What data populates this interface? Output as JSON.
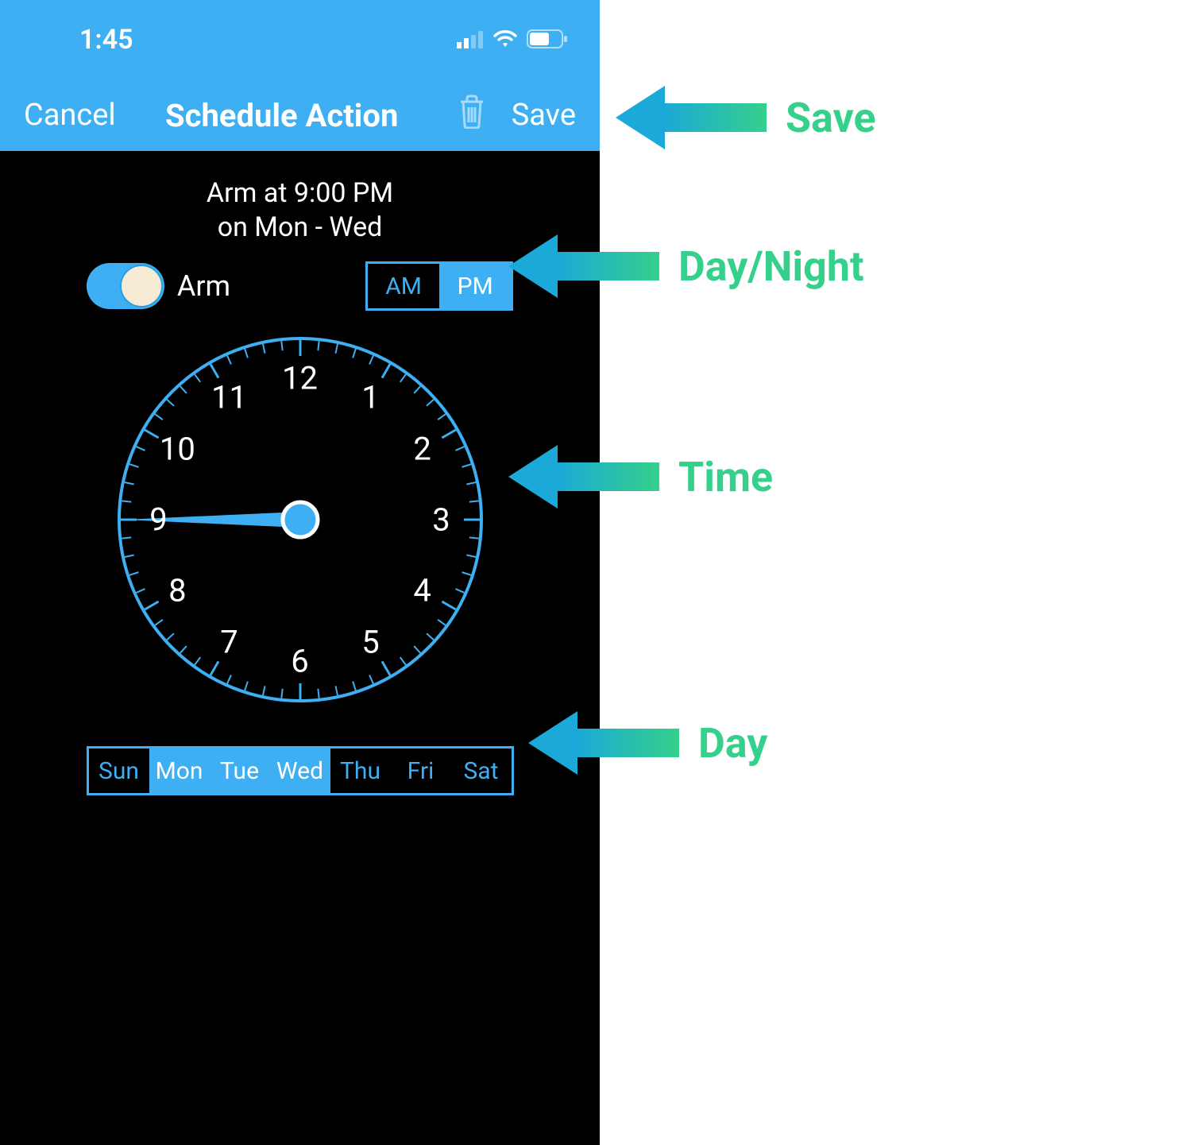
{
  "status": {
    "time": "1:45"
  },
  "nav": {
    "cancel": "Cancel",
    "title": "Schedule Action",
    "save": "Save"
  },
  "summary": {
    "line1": "Arm at 9:00 PM",
    "line2": "on Mon - Wed"
  },
  "arm": {
    "label": "Arm",
    "on": true
  },
  "ampm": {
    "am": "AM",
    "pm": "PM",
    "selected": "PM"
  },
  "clock": {
    "selected_hour": 9,
    "numbers": [
      "12",
      "1",
      "2",
      "3",
      "4",
      "5",
      "6",
      "7",
      "8",
      "9",
      "10",
      "11"
    ]
  },
  "days": {
    "items": [
      {
        "label": "Sun",
        "active": false
      },
      {
        "label": "Mon",
        "active": true
      },
      {
        "label": "Tue",
        "active": true
      },
      {
        "label": "Wed",
        "active": true
      },
      {
        "label": "Thu",
        "active": false
      },
      {
        "label": "Fri",
        "active": false
      },
      {
        "label": "Sat",
        "active": false
      }
    ]
  },
  "annotations": {
    "save": "Save",
    "daynight": "Day/Night",
    "time": "Time",
    "day": "Day"
  },
  "colors": {
    "accent": "#3daff2",
    "anno": "#35d08b"
  }
}
